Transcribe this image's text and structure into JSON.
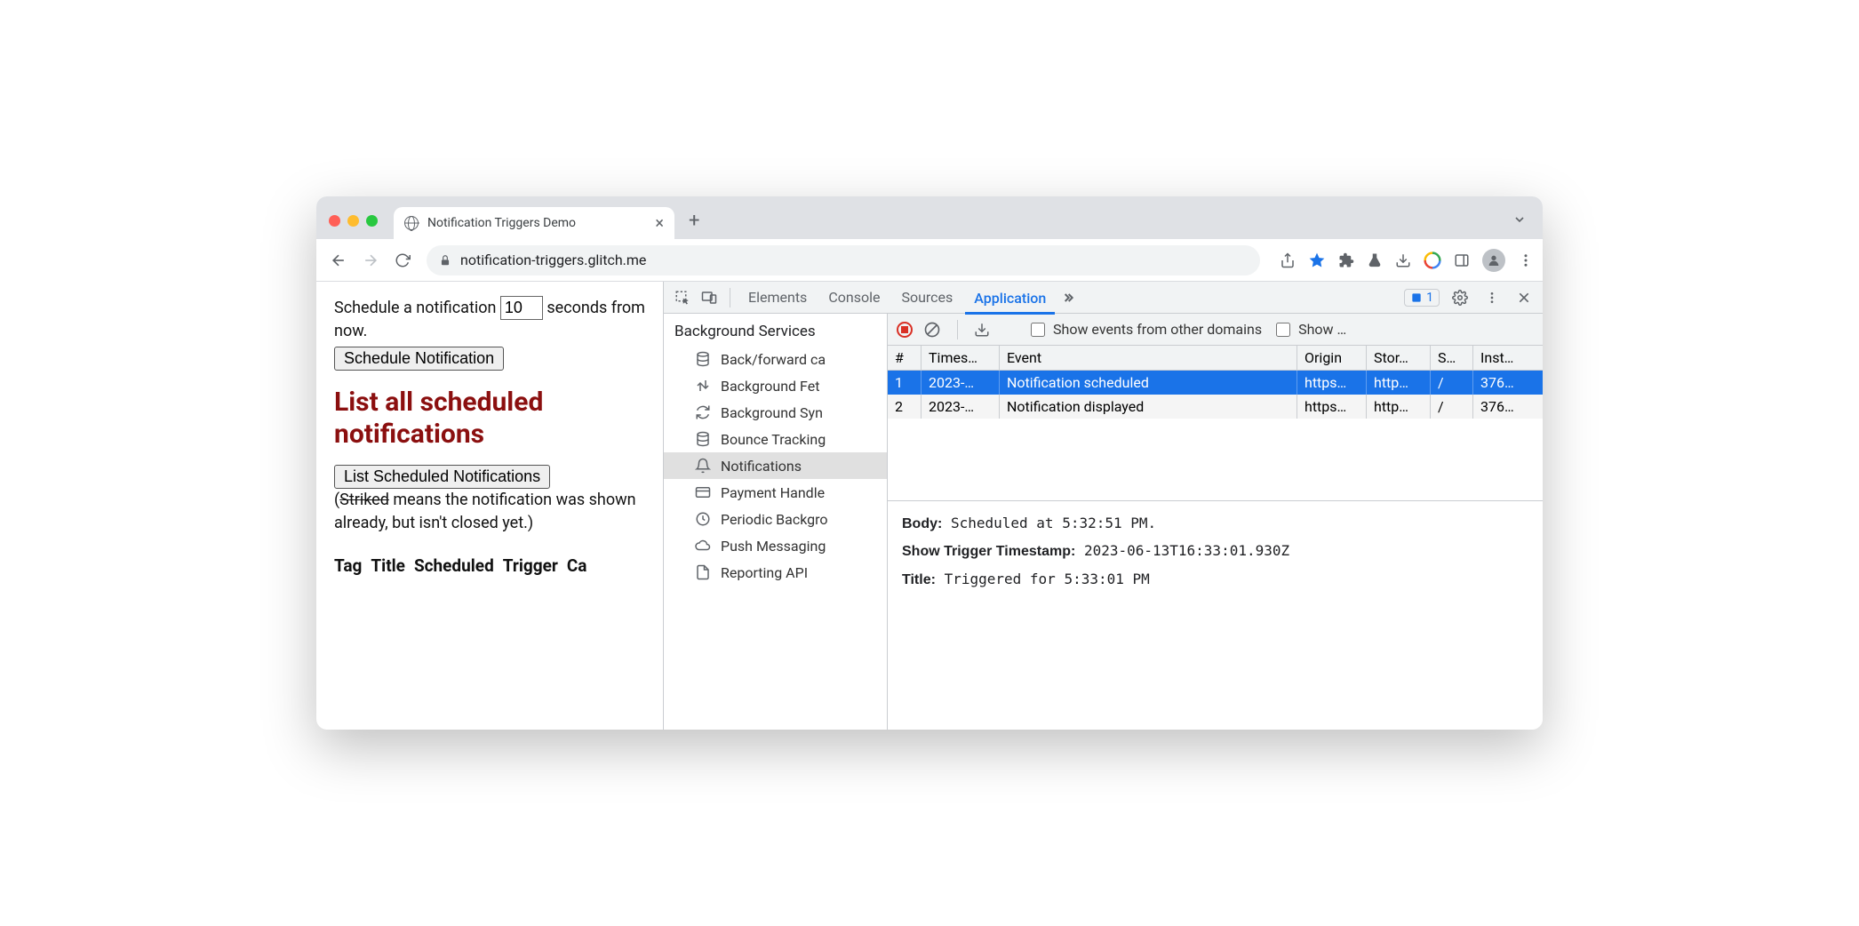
{
  "browser": {
    "tab_title": "Notification Triggers Demo",
    "url_display": "notification-triggers.glitch.me"
  },
  "page": {
    "schedule_text_before": "Schedule a notification",
    "schedule_input_value": "10",
    "schedule_text_after": "seconds from now.",
    "schedule_button": "Schedule Notification",
    "heading": "List all scheduled notifications",
    "list_button": "List Scheduled Notifications",
    "hint_open": "(",
    "hint_striked": "Striked",
    "hint_rest": " means the notification was shown already, but isn't closed yet.)",
    "table_headers": [
      "Tag",
      "Title",
      "Scheduled",
      "Trigger",
      "Ca"
    ]
  },
  "devtools": {
    "tabs": [
      "Elements",
      "Console",
      "Sources",
      "Application"
    ],
    "active_tab": "Application",
    "issues_count": "1",
    "sidebar": {
      "section": "Background Services",
      "items": [
        {
          "icon": "db",
          "label": "Back/forward ca"
        },
        {
          "icon": "updown",
          "label": "Background Fet"
        },
        {
          "icon": "sync",
          "label": "Background Syn"
        },
        {
          "icon": "db",
          "label": "Bounce Tracking"
        },
        {
          "icon": "bell",
          "label": "Notifications",
          "selected": true
        },
        {
          "icon": "card",
          "label": "Payment Handle"
        },
        {
          "icon": "clock",
          "label": "Periodic Backgro"
        },
        {
          "icon": "cloud",
          "label": "Push Messaging"
        },
        {
          "icon": "doc",
          "label": "Reporting API"
        }
      ]
    },
    "toolbar2": {
      "checkbox1_label": "Show events from other domains",
      "checkbox2_label": "Show …"
    },
    "table": {
      "columns": [
        "#",
        "Times…",
        "Event",
        "Origin",
        "Stor…",
        "S…",
        "Inst…"
      ],
      "rows": [
        {
          "n": "1",
          "ts": "2023-…",
          "event": "Notification scheduled",
          "origin": "https…",
          "stor": "http…",
          "s": "/",
          "inst": "376…",
          "selected": true
        },
        {
          "n": "2",
          "ts": "2023-…",
          "event": "Notification displayed",
          "origin": "https…",
          "stor": "http…",
          "s": "/",
          "inst": "376…",
          "selected": false
        }
      ]
    },
    "details": {
      "body_label": "Body:",
      "body_value": "Scheduled at 5:32:51 PM.",
      "trigger_label": "Show Trigger Timestamp:",
      "trigger_value": "2023-06-13T16:33:01.930Z",
      "title_label": "Title:",
      "title_value": "Triggered for 5:33:01 PM"
    }
  }
}
